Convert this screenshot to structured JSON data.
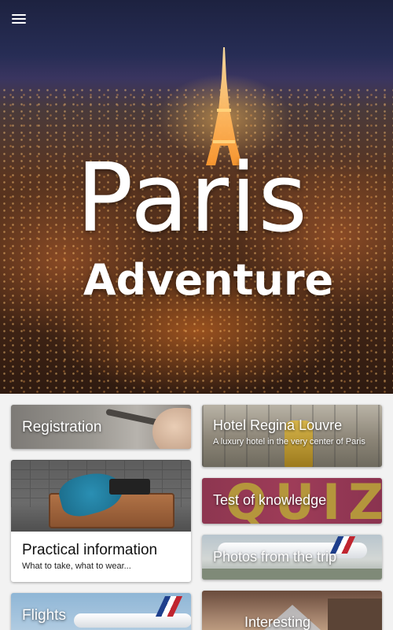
{
  "hero": {
    "title_line1": "Paris",
    "title_line2": "Adventure"
  },
  "menu": {
    "icon": "hamburger-menu-icon"
  },
  "cards": {
    "registration": {
      "title": "Registration"
    },
    "practical": {
      "title": "Practical information",
      "subtitle": "What to take, what to wear..."
    },
    "flights": {
      "title": "Flights"
    },
    "hotel": {
      "title": "Hotel Regina Louvre",
      "subtitle": "A luxury hotel in the very center of Paris"
    },
    "quiz": {
      "title": "Test of knowledge",
      "background_word": "QUIZ"
    },
    "photos": {
      "title": "Photos from the trip"
    },
    "interesting": {
      "title": "Interesting"
    }
  },
  "colors": {
    "card_text": "#ffffff",
    "quiz_bg": "#9e3c58",
    "page_bg": "#f2f2f2"
  }
}
